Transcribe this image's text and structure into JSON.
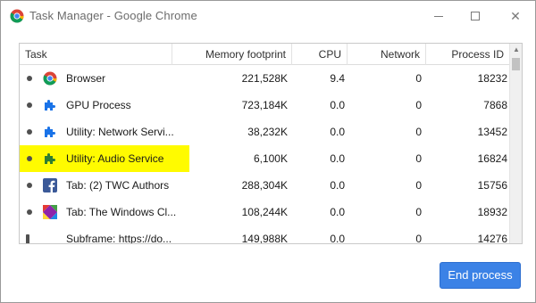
{
  "window": {
    "title": "Task Manager - Google Chrome",
    "controls": {
      "minimize": "minimize",
      "maximize": "maximize",
      "close": "✕"
    }
  },
  "table": {
    "columns": [
      "Task",
      "Memory footprint",
      "CPU",
      "Network",
      "Process ID"
    ],
    "rows": [
      {
        "icon": "chrome-icon",
        "name": "Browser",
        "memory": "221,528K",
        "cpu": "9.4",
        "network": "0",
        "pid": "18232",
        "highlighted": false
      },
      {
        "icon": "puzzle-icon",
        "name": "GPU Process",
        "memory": "723,184K",
        "cpu": "0.0",
        "network": "0",
        "pid": "7868",
        "highlighted": false
      },
      {
        "icon": "puzzle-icon",
        "name": "Utility: Network Servi...",
        "memory": "38,232K",
        "cpu": "0.0",
        "network": "0",
        "pid": "13452",
        "highlighted": false
      },
      {
        "icon": "puzzle-icon",
        "name": "Utility: Audio Service",
        "memory": "6,100K",
        "cpu": "0.0",
        "network": "0",
        "pid": "16824",
        "highlighted": true
      },
      {
        "icon": "facebook-icon",
        "name": "Tab: (2) TWC Authors",
        "memory": "288,304K",
        "cpu": "0.0",
        "network": "0",
        "pid": "15756",
        "highlighted": false
      },
      {
        "icon": "twc-logo-icon",
        "name": "Tab: The Windows Cl...",
        "memory": "108,244K",
        "cpu": "0.0",
        "network": "0",
        "pid": "18932",
        "highlighted": false
      },
      {
        "icon": "page-icon",
        "name": "Subframe: https://do...",
        "memory": "149,988K",
        "cpu": "0.0",
        "network": "0",
        "pid": "14276",
        "highlighted": false
      }
    ]
  },
  "actions": {
    "end_process": "End process"
  },
  "colors": {
    "highlight": "#fffb00",
    "button": "#3b82e6",
    "puzzle_blue": "#1a73e8",
    "puzzle_green": "#2e7d32"
  }
}
